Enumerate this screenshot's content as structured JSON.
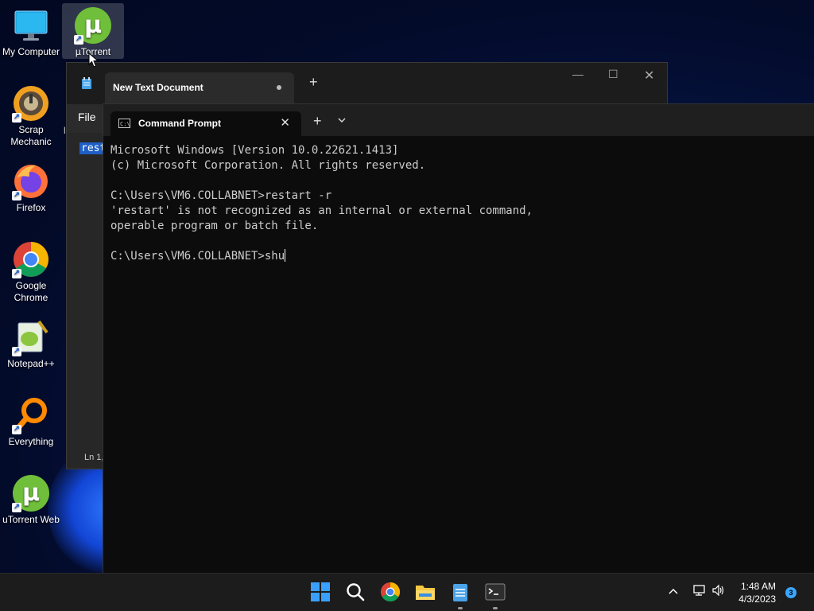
{
  "desktop": {
    "icons": [
      {
        "label": "My Computer"
      },
      {
        "label": "µTorrent"
      },
      {
        "label": "Scrap Mechanic"
      },
      {
        "label": "Firefox"
      },
      {
        "label": "Google Chrome"
      },
      {
        "label": "Notepad++"
      },
      {
        "label": "Everything"
      },
      {
        "label": "uTorrent Web"
      }
    ]
  },
  "notepad": {
    "tab_title": "New Text Document",
    "menu_file": "File",
    "selected_text": "rest",
    "status": "Ln 1,",
    "partial_char": "l"
  },
  "terminal": {
    "tab_title": "Command Prompt",
    "tab_icon_text": "C:\\",
    "lines": [
      "Microsoft Windows [Version 10.0.22621.1413]",
      "(c) Microsoft Corporation. All rights reserved.",
      "",
      "C:\\Users\\VM6.COLLABNET>restart -r",
      "'restart' is not recognized as an internal or external command,",
      "operable program or batch file.",
      ""
    ],
    "current_prompt": "C:\\Users\\VM6.COLLABNET>shu"
  },
  "taskbar": {
    "time": "1:48 AM",
    "date": "4/3/2023",
    "notification_count": "3"
  },
  "colors": {
    "accent": "#1f5fc6",
    "terminal_bg": "#0c0c0c",
    "taskbar_bg": "#1c1c1c"
  }
}
